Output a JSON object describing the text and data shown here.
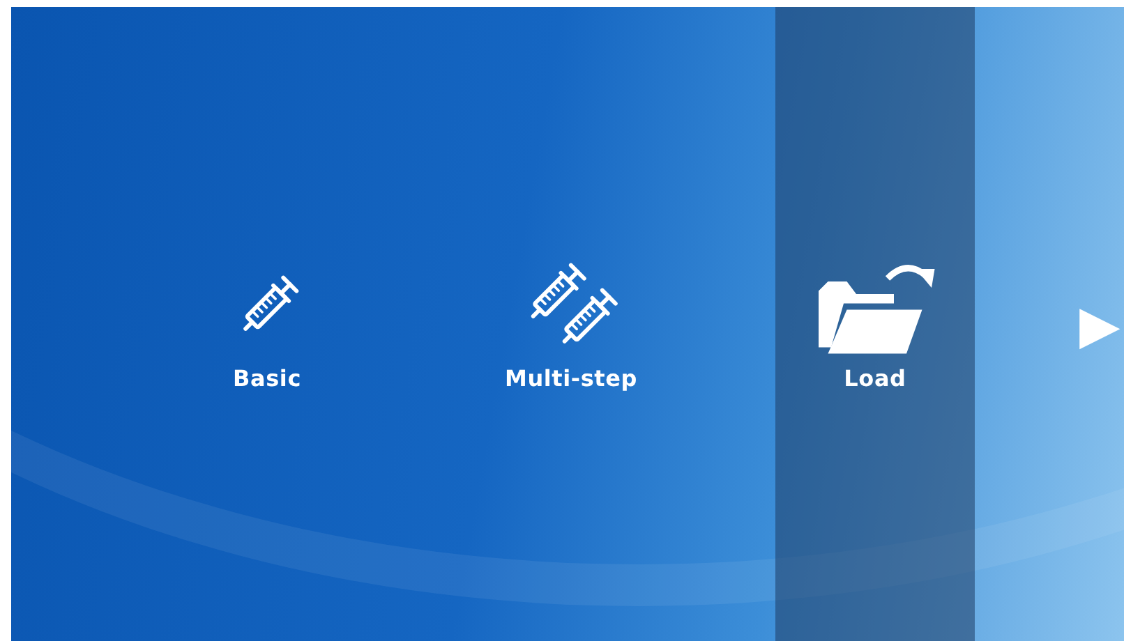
{
  "menu": {
    "items": [
      {
        "label": "Basic",
        "kind": "syringe",
        "selected": false
      },
      {
        "label": "Multi-step",
        "kind": "syringes",
        "selected": false
      },
      {
        "label": "Load",
        "kind": "folder",
        "selected": true
      }
    ]
  },
  "next_arrow": "▶"
}
